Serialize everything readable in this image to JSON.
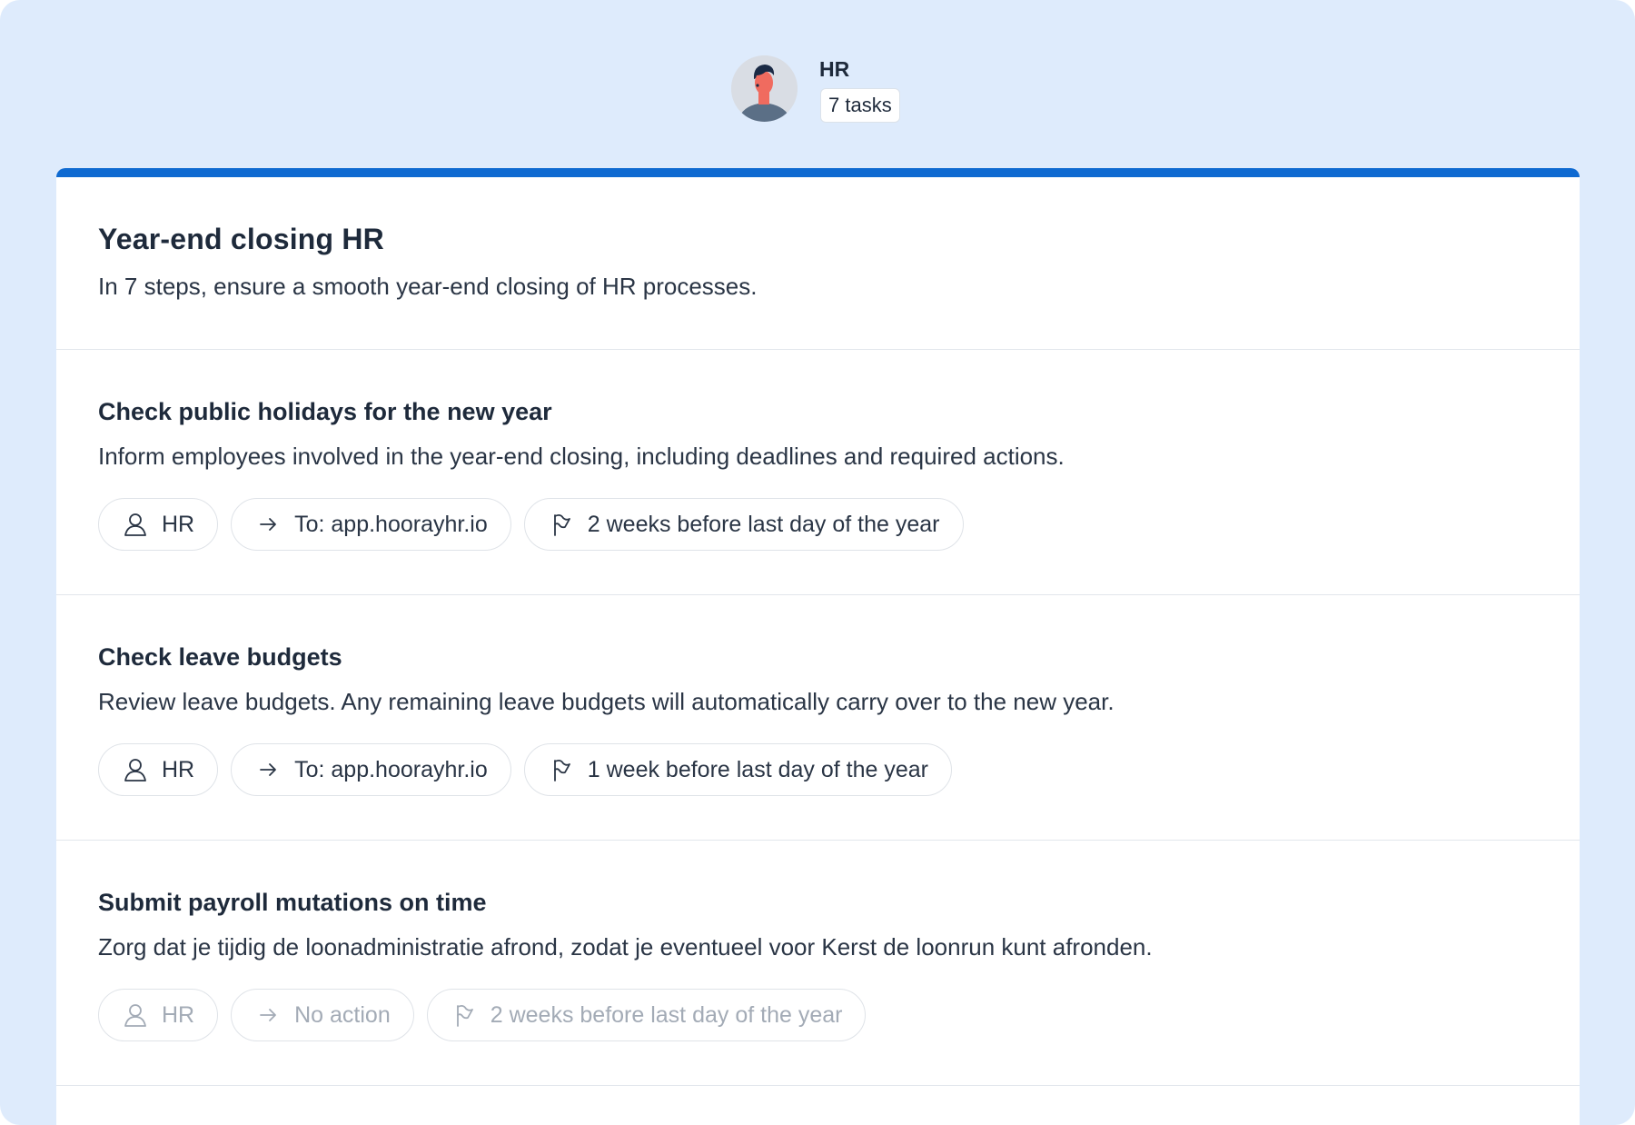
{
  "header": {
    "name": "HR",
    "task_count": "7 tasks"
  },
  "intro": {
    "title": "Year-end closing HR",
    "subtitle": "In 7 steps, ensure a smooth year-end closing of HR processes."
  },
  "tasks": [
    {
      "title": "Check public holidays for the new year",
      "description": "Inform employees involved in the year-end closing, including deadlines and required actions.",
      "assignee": "HR",
      "action": "To: app.hoorayhr.io",
      "deadline": "2 weeks before last day of the year"
    },
    {
      "title": "Check leave budgets",
      "description": "Review leave budgets. Any remaining leave budgets will automatically carry over to the new year.",
      "assignee": "HR",
      "action": "To: app.hoorayhr.io",
      "deadline": "1 week before last day of the year"
    },
    {
      "title": "Submit payroll mutations on time",
      "description": "Zorg dat je tijdig de loonadministratie afrond, zodat je eventueel voor Kerst de loonrun kunt afronden.",
      "assignee": "HR",
      "action": "No action",
      "deadline": "2 weeks before last day of the year"
    }
  ],
  "icons": {
    "assignee": "user-icon",
    "action": "arrow-right-icon",
    "deadline": "flag-icon"
  },
  "colors": {
    "accent": "#0f6ad1",
    "background": "#deebfc",
    "muted_text": "#a3abb6"
  }
}
